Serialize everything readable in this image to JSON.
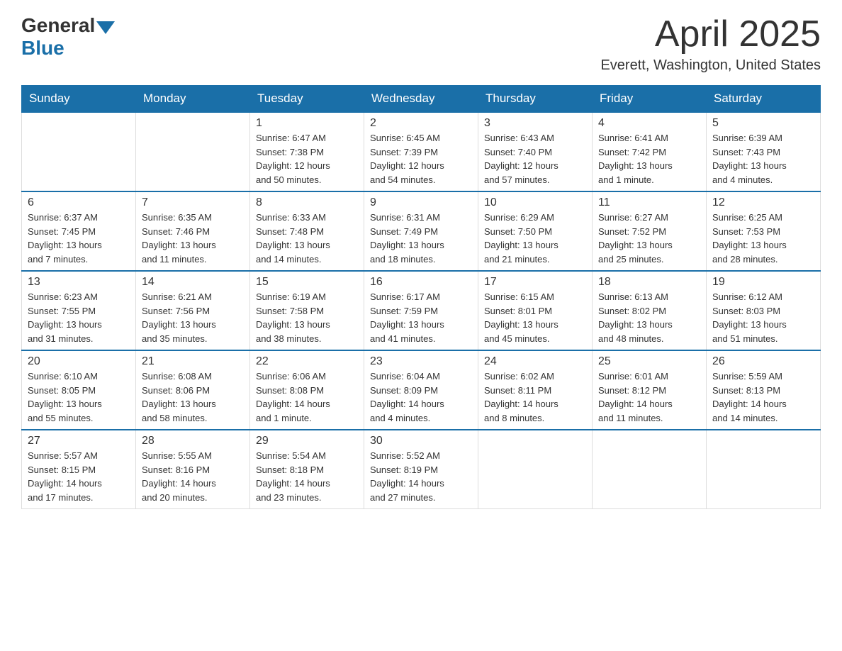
{
  "header": {
    "logo_general": "General",
    "logo_blue": "Blue",
    "month_title": "April 2025",
    "location": "Everett, Washington, United States"
  },
  "days_of_week": [
    "Sunday",
    "Monday",
    "Tuesday",
    "Wednesday",
    "Thursday",
    "Friday",
    "Saturday"
  ],
  "weeks": [
    [
      {
        "day": "",
        "info": ""
      },
      {
        "day": "",
        "info": ""
      },
      {
        "day": "1",
        "info": "Sunrise: 6:47 AM\nSunset: 7:38 PM\nDaylight: 12 hours\nand 50 minutes."
      },
      {
        "day": "2",
        "info": "Sunrise: 6:45 AM\nSunset: 7:39 PM\nDaylight: 12 hours\nand 54 minutes."
      },
      {
        "day": "3",
        "info": "Sunrise: 6:43 AM\nSunset: 7:40 PM\nDaylight: 12 hours\nand 57 minutes."
      },
      {
        "day": "4",
        "info": "Sunrise: 6:41 AM\nSunset: 7:42 PM\nDaylight: 13 hours\nand 1 minute."
      },
      {
        "day": "5",
        "info": "Sunrise: 6:39 AM\nSunset: 7:43 PM\nDaylight: 13 hours\nand 4 minutes."
      }
    ],
    [
      {
        "day": "6",
        "info": "Sunrise: 6:37 AM\nSunset: 7:45 PM\nDaylight: 13 hours\nand 7 minutes."
      },
      {
        "day": "7",
        "info": "Sunrise: 6:35 AM\nSunset: 7:46 PM\nDaylight: 13 hours\nand 11 minutes."
      },
      {
        "day": "8",
        "info": "Sunrise: 6:33 AM\nSunset: 7:48 PM\nDaylight: 13 hours\nand 14 minutes."
      },
      {
        "day": "9",
        "info": "Sunrise: 6:31 AM\nSunset: 7:49 PM\nDaylight: 13 hours\nand 18 minutes."
      },
      {
        "day": "10",
        "info": "Sunrise: 6:29 AM\nSunset: 7:50 PM\nDaylight: 13 hours\nand 21 minutes."
      },
      {
        "day": "11",
        "info": "Sunrise: 6:27 AM\nSunset: 7:52 PM\nDaylight: 13 hours\nand 25 minutes."
      },
      {
        "day": "12",
        "info": "Sunrise: 6:25 AM\nSunset: 7:53 PM\nDaylight: 13 hours\nand 28 minutes."
      }
    ],
    [
      {
        "day": "13",
        "info": "Sunrise: 6:23 AM\nSunset: 7:55 PM\nDaylight: 13 hours\nand 31 minutes."
      },
      {
        "day": "14",
        "info": "Sunrise: 6:21 AM\nSunset: 7:56 PM\nDaylight: 13 hours\nand 35 minutes."
      },
      {
        "day": "15",
        "info": "Sunrise: 6:19 AM\nSunset: 7:58 PM\nDaylight: 13 hours\nand 38 minutes."
      },
      {
        "day": "16",
        "info": "Sunrise: 6:17 AM\nSunset: 7:59 PM\nDaylight: 13 hours\nand 41 minutes."
      },
      {
        "day": "17",
        "info": "Sunrise: 6:15 AM\nSunset: 8:01 PM\nDaylight: 13 hours\nand 45 minutes."
      },
      {
        "day": "18",
        "info": "Sunrise: 6:13 AM\nSunset: 8:02 PM\nDaylight: 13 hours\nand 48 minutes."
      },
      {
        "day": "19",
        "info": "Sunrise: 6:12 AM\nSunset: 8:03 PM\nDaylight: 13 hours\nand 51 minutes."
      }
    ],
    [
      {
        "day": "20",
        "info": "Sunrise: 6:10 AM\nSunset: 8:05 PM\nDaylight: 13 hours\nand 55 minutes."
      },
      {
        "day": "21",
        "info": "Sunrise: 6:08 AM\nSunset: 8:06 PM\nDaylight: 13 hours\nand 58 minutes."
      },
      {
        "day": "22",
        "info": "Sunrise: 6:06 AM\nSunset: 8:08 PM\nDaylight: 14 hours\nand 1 minute."
      },
      {
        "day": "23",
        "info": "Sunrise: 6:04 AM\nSunset: 8:09 PM\nDaylight: 14 hours\nand 4 minutes."
      },
      {
        "day": "24",
        "info": "Sunrise: 6:02 AM\nSunset: 8:11 PM\nDaylight: 14 hours\nand 8 minutes."
      },
      {
        "day": "25",
        "info": "Sunrise: 6:01 AM\nSunset: 8:12 PM\nDaylight: 14 hours\nand 11 minutes."
      },
      {
        "day": "26",
        "info": "Sunrise: 5:59 AM\nSunset: 8:13 PM\nDaylight: 14 hours\nand 14 minutes."
      }
    ],
    [
      {
        "day": "27",
        "info": "Sunrise: 5:57 AM\nSunset: 8:15 PM\nDaylight: 14 hours\nand 17 minutes."
      },
      {
        "day": "28",
        "info": "Sunrise: 5:55 AM\nSunset: 8:16 PM\nDaylight: 14 hours\nand 20 minutes."
      },
      {
        "day": "29",
        "info": "Sunrise: 5:54 AM\nSunset: 8:18 PM\nDaylight: 14 hours\nand 23 minutes."
      },
      {
        "day": "30",
        "info": "Sunrise: 5:52 AM\nSunset: 8:19 PM\nDaylight: 14 hours\nand 27 minutes."
      },
      {
        "day": "",
        "info": ""
      },
      {
        "day": "",
        "info": ""
      },
      {
        "day": "",
        "info": ""
      }
    ]
  ]
}
